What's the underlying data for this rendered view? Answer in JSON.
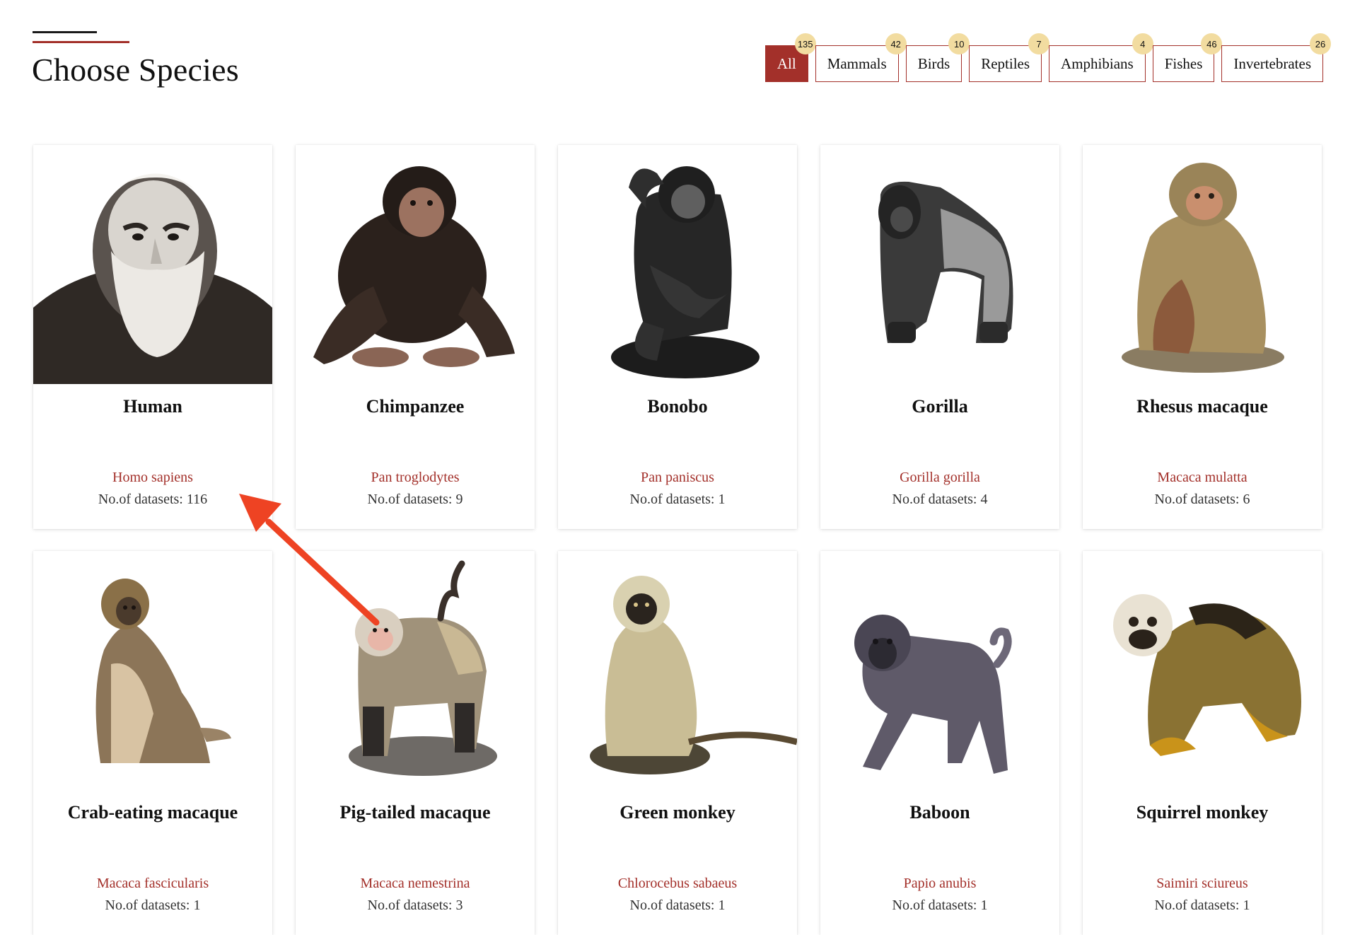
{
  "header": {
    "title": "Choose Species"
  },
  "filters": [
    {
      "label": "All",
      "count": "135",
      "active": true
    },
    {
      "label": "Mammals",
      "count": "42"
    },
    {
      "label": "Birds",
      "count": "10"
    },
    {
      "label": "Reptiles",
      "count": "7"
    },
    {
      "label": "Amphibians",
      "count": "4"
    },
    {
      "label": "Fishes",
      "count": "46"
    },
    {
      "label": "Invertebrates",
      "count": "26"
    }
  ],
  "species": [
    {
      "name": "Human",
      "scientific": "Homo sapiens",
      "datasets": "No.of datasets: 116",
      "icon": "human-portrait-icon",
      "color": "#2a2522"
    },
    {
      "name": "Chimpanzee",
      "scientific": "Pan troglodytes",
      "datasets": "No.of datasets: 9",
      "icon": "chimpanzee-icon",
      "color": "#2b211c"
    },
    {
      "name": "Bonobo",
      "scientific": "Pan paniscus",
      "datasets": "No.of datasets: 1",
      "icon": "bonobo-icon",
      "color": "#1f1f1f"
    },
    {
      "name": "Gorilla",
      "scientific": "Gorilla gorilla",
      "datasets": "No.of datasets: 4",
      "icon": "gorilla-icon",
      "color": "#2c2c2c"
    },
    {
      "name": "Rhesus macaque",
      "scientific": "Macaca mulatta",
      "datasets": "No.of datasets: 6",
      "icon": "rhesus-macaque-icon",
      "color": "#a89060"
    },
    {
      "name": "Crab-eating macaque",
      "scientific": "Macaca fascicularis",
      "datasets": "No.of datasets: 1",
      "icon": "crab-eating-macaque-icon",
      "color": "#8c7558"
    },
    {
      "name": "Pig-tailed macaque",
      "scientific": "Macaca nemestrina",
      "datasets": "No.of datasets: 3",
      "icon": "pig-tailed-macaque-icon",
      "color": "#a0927a"
    },
    {
      "name": "Green monkey",
      "scientific": "Chlorocebus sabaeus",
      "datasets": "No.of datasets: 1",
      "icon": "green-monkey-icon",
      "color": "#c9bd95"
    },
    {
      "name": "Baboon",
      "scientific": "Papio anubis",
      "datasets": "No.of datasets: 1",
      "icon": "baboon-icon",
      "color": "#5f5a69"
    },
    {
      "name": "Squirrel monkey",
      "scientific": "Saimiri sciureus",
      "datasets": "No.of datasets: 1",
      "icon": "squirrel-monkey-icon",
      "color": "#8a7233"
    }
  ]
}
